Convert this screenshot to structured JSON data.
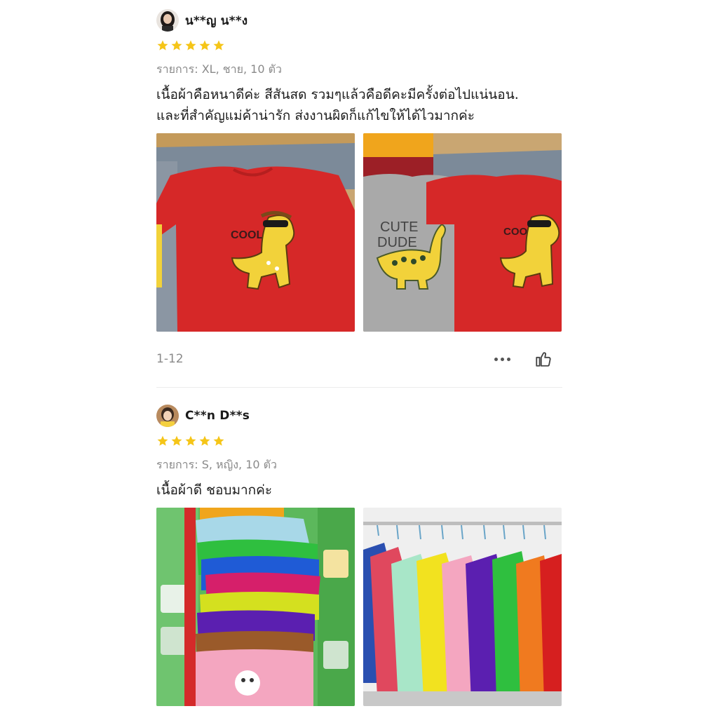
{
  "reviews": [
    {
      "reviewer": "น**ญ น**ง",
      "rating": 5,
      "variation": "รายการ: XL, ชาย, 10 ตัว",
      "comment_line1": "เนื้อผ้าคือหนาดีค่ะ สีสันสด รวมๆแล้วคือดีคะมีครั้งต่อไปแน่นอน.",
      "comment_line2": "และที่สำคัญแม่ค้าน่ารัก ส่งงานผิดก็แก้ไขให้ได้ไวมากค่ะ",
      "photo1_text": "COOL BOY",
      "photo2_text_a": "CUTE",
      "photo2_text_b": "DUDE",
      "photo2_text_c": "COOL BOY",
      "date": "1-12"
    },
    {
      "reviewer": "C**n D**s",
      "rating": 5,
      "variation": "รายการ: S, หญิง, 10 ตัว",
      "comment": "เนื้อผ้าดี ชอบมากค่ะ"
    }
  ],
  "colors": {
    "star": "#f5c518",
    "meta_text": "#8a8a8a",
    "shirt_red": "#d62828"
  },
  "icons": [
    "star-icon",
    "more-options-icon",
    "thumbs-up-icon"
  ]
}
